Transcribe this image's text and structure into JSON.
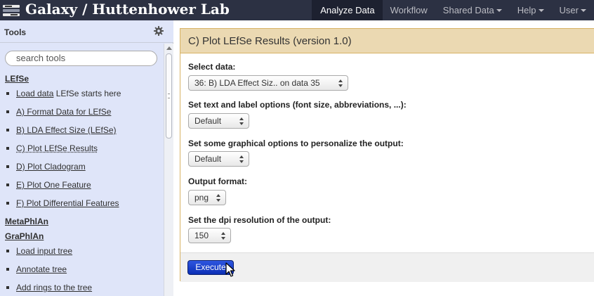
{
  "masthead": {
    "brand": "Galaxy / Huttenhower Lab",
    "nav": [
      {
        "label": "Analyze Data",
        "active": true,
        "dropdown": false
      },
      {
        "label": "Workflow",
        "active": false,
        "dropdown": false
      },
      {
        "label": "Shared Data",
        "active": false,
        "dropdown": true
      },
      {
        "label": "Help",
        "active": false,
        "dropdown": true
      },
      {
        "label": "User",
        "active": false,
        "dropdown": true
      }
    ],
    "bg_color": "#2c3143"
  },
  "tools_panel": {
    "title": "Tools",
    "options_icon": "gear-icon",
    "search_placeholder": "search tools",
    "sections": [
      {
        "name": "LEfSe",
        "tools": [
          {
            "link": "Load data",
            "suffix": " LEfSe starts here"
          },
          {
            "link": "A) Format Data for LEfSe",
            "suffix": ""
          },
          {
            "link": "B) LDA Effect Size (LEfSe)",
            "suffix": ""
          },
          {
            "link": "C) Plot LEfSe Results",
            "suffix": ""
          },
          {
            "link": "D) Plot Cladogram",
            "suffix": ""
          },
          {
            "link": "E) Plot One Feature",
            "suffix": ""
          },
          {
            "link": "F) Plot Differential Features",
            "suffix": ""
          }
        ]
      },
      {
        "name": "MetaPhlAn",
        "tools": []
      },
      {
        "name": "GraPhlAn",
        "tools": [
          {
            "link": "Load input tree",
            "suffix": ""
          },
          {
            "link": "Annotate tree",
            "suffix": ""
          },
          {
            "link": "Add rings to the tree",
            "suffix": ""
          }
        ]
      }
    ]
  },
  "tool_form": {
    "title": "C) Plot LEfSe Results (version 1.0)",
    "fields": [
      {
        "label": "Select data:",
        "value": "36: B) LDA Effect Siz.. on data 35"
      },
      {
        "label": "Set text and label options (font size, abbreviations, ...):",
        "value": "Default"
      },
      {
        "label": "Set some graphical options to personalize the output:",
        "value": "Default"
      },
      {
        "label": "Output format:",
        "value": "png"
      },
      {
        "label": "Set the dpi resolution of the output:",
        "value": "150"
      }
    ],
    "execute_label": "Execute",
    "header_color": "#ebd9b2",
    "button_color": "#1f45d2"
  }
}
